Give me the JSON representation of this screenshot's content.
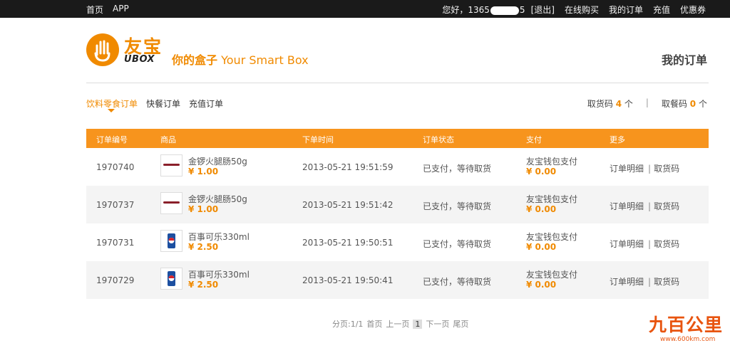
{
  "topbar": {
    "left": [
      "首页",
      "APP"
    ],
    "greeting_prefix": "您好，1365",
    "greeting_suffix": "5",
    "logout": "[退出]",
    "right": [
      "在线购买",
      "我的订单",
      "充值",
      "优惠券"
    ]
  },
  "brand": {
    "cn": "友宝",
    "en": "UBOX",
    "tagline_cn": "你的盒子",
    "tagline_en": "Your Smart Box"
  },
  "page_title": "我的订单",
  "tabs": [
    "饮料零食订单",
    "快餐订单",
    "充值订单"
  ],
  "codes": {
    "pickup_label": "取货码",
    "pickup_count": "4",
    "pickup_unit": "个",
    "meal_label": "取餐码",
    "meal_count": "0",
    "meal_unit": "个",
    "separator": "|"
  },
  "table": {
    "headers": [
      "订单编号",
      "商品",
      "下单时间",
      "订单状态",
      "支付",
      "更多"
    ],
    "rows": [
      {
        "id": "1970740",
        "product": "金锣火腿肠50g",
        "price": "¥ 1.00",
        "time": "2013-05-21 19:51:59",
        "status": "已支付，等待取货",
        "pay": "友宝钱包支付",
        "paid": "¥ 0.00",
        "detail": "订单明细",
        "code": "取货码",
        "icon": "sausage-icon"
      },
      {
        "id": "1970737",
        "product": "金锣火腿肠50g",
        "price": "¥ 1.00",
        "time": "2013-05-21 19:51:42",
        "status": "已支付，等待取货",
        "pay": "友宝钱包支付",
        "paid": "¥ 0.00",
        "detail": "订单明细",
        "code": "取货码",
        "icon": "sausage-icon"
      },
      {
        "id": "1970731",
        "product": "百事可乐330ml",
        "price": "¥ 2.50",
        "time": "2013-05-21 19:50:51",
        "status": "已支付，等待取货",
        "pay": "友宝钱包支付",
        "paid": "¥ 0.00",
        "detail": "订单明细",
        "code": "取货码",
        "icon": "pepsi-can-icon"
      },
      {
        "id": "1970729",
        "product": "百事可乐330ml",
        "price": "¥ 2.50",
        "time": "2013-05-21 19:50:41",
        "status": "已支付，等待取货",
        "pay": "友宝钱包支付",
        "paid": "¥ 0.00",
        "detail": "订单明细",
        "code": "取货码",
        "icon": "pepsi-can-icon"
      }
    ]
  },
  "pager": {
    "info": "分页:1/1",
    "first": "首页",
    "prev": "上一页",
    "current": "1",
    "next": "下一页",
    "last": "尾页"
  },
  "watermark": {
    "big": "九百公里",
    "small": "www.600km.com"
  },
  "colors": {
    "accent": "#f7941d",
    "topbar": "#1a1a1a"
  }
}
